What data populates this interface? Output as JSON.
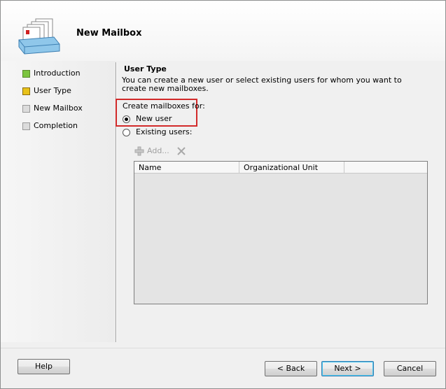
{
  "header": {
    "title": "New Mailbox"
  },
  "steps": [
    {
      "label": "Introduction",
      "status": "done",
      "color": "#7cc540"
    },
    {
      "label": "User Type",
      "status": "current",
      "color": "#e8c21a"
    },
    {
      "label": "New Mailbox",
      "status": "pending",
      "color": "#d8d8d8"
    },
    {
      "label": "Completion",
      "status": "pending",
      "color": "#d8d8d8"
    }
  ],
  "main": {
    "section_title": "User Type",
    "description": "You can create a new user or select existing users for whom you want to create new mailboxes.",
    "create_label": "Create mailboxes for:",
    "options": [
      {
        "label": "New user",
        "selected": true
      },
      {
        "label": "Existing users:",
        "selected": false
      }
    ],
    "toolbar": {
      "add_label": "Add...",
      "add_icon": "add-icon",
      "remove_icon": "remove-icon"
    },
    "table": {
      "columns": [
        "Name",
        "Organizational Unit",
        ""
      ],
      "rows": []
    }
  },
  "footer": {
    "help": "Help",
    "back": "< Back",
    "next": "Next >",
    "cancel": "Cancel"
  },
  "colors": {
    "highlight": "#d22a2a"
  }
}
